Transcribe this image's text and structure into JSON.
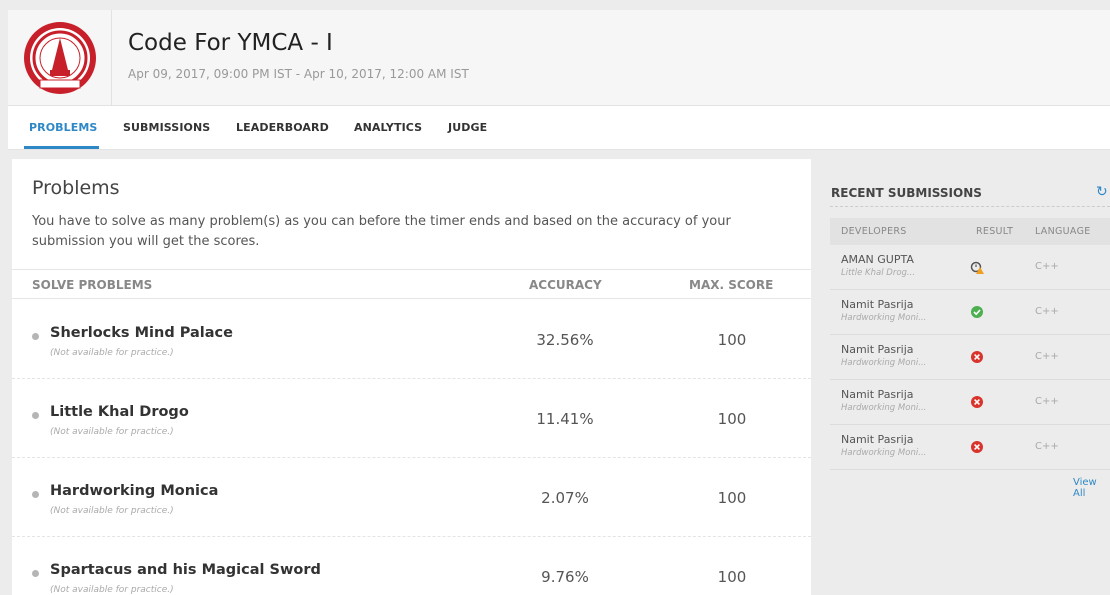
{
  "header": {
    "title": "Code For YMCA - I",
    "subtitle": "Apr 09, 2017, 09:00 PM IST - Apr 10, 2017, 12:00 AM IST"
  },
  "tabs": [
    {
      "label": "PROBLEMS",
      "active": true
    },
    {
      "label": "SUBMISSIONS",
      "active": false
    },
    {
      "label": "LEADERBOARD",
      "active": false
    },
    {
      "label": "ANALYTICS",
      "active": false
    },
    {
      "label": "JUDGE",
      "active": false
    }
  ],
  "main": {
    "title": "Problems",
    "description": "You have to solve as many problem(s) as you can before the timer ends and based on the accuracy of your submission you will get the scores.",
    "columns": {
      "problem": "SOLVE PROBLEMS",
      "accuracy": "ACCURACY",
      "score": "MAX. SCORE"
    },
    "problems": [
      {
        "name": "Sherlocks Mind Palace",
        "note": "(Not available for practice.)",
        "accuracy": "32.56%",
        "score": "100"
      },
      {
        "name": "Little Khal Drogo",
        "note": "(Not available for practice.)",
        "accuracy": "11.41%",
        "score": "100"
      },
      {
        "name": "Hardworking Monica",
        "note": "(Not available for practice.)",
        "accuracy": "2.07%",
        "score": "100"
      },
      {
        "name": "Spartacus and his Magical Sword",
        "note": "(Not available for practice.)",
        "accuracy": "9.76%",
        "score": "100"
      }
    ]
  },
  "sidebar": {
    "title": "RECENT SUBMISSIONS",
    "refresh_icon": "refresh-icon",
    "columns": {
      "developer": "DEVELOPERS",
      "result": "RESULT",
      "language": "LANGUAGE"
    },
    "submissions": [
      {
        "developer": "AMAN GUPTA",
        "problem": "Little Khal Drog...",
        "result": "time-limit",
        "language": "C++"
      },
      {
        "developer": "Namit Pasrija",
        "problem": "Hardworking Moni...",
        "result": "accepted",
        "language": "C++"
      },
      {
        "developer": "Namit Pasrija",
        "problem": "Hardworking Moni...",
        "result": "wrong",
        "language": "C++"
      },
      {
        "developer": "Namit Pasrija",
        "problem": "Hardworking Moni...",
        "result": "wrong",
        "language": "C++"
      },
      {
        "developer": "Namit Pasrija",
        "problem": "Hardworking Moni...",
        "result": "wrong",
        "language": "C++"
      }
    ],
    "view_all": "View All"
  },
  "colors": {
    "accent": "#2f88c6",
    "accepted": "#4caf50",
    "wrong": "#d9342b",
    "warning": "#f0a020",
    "logo_red": "#c8202a"
  }
}
